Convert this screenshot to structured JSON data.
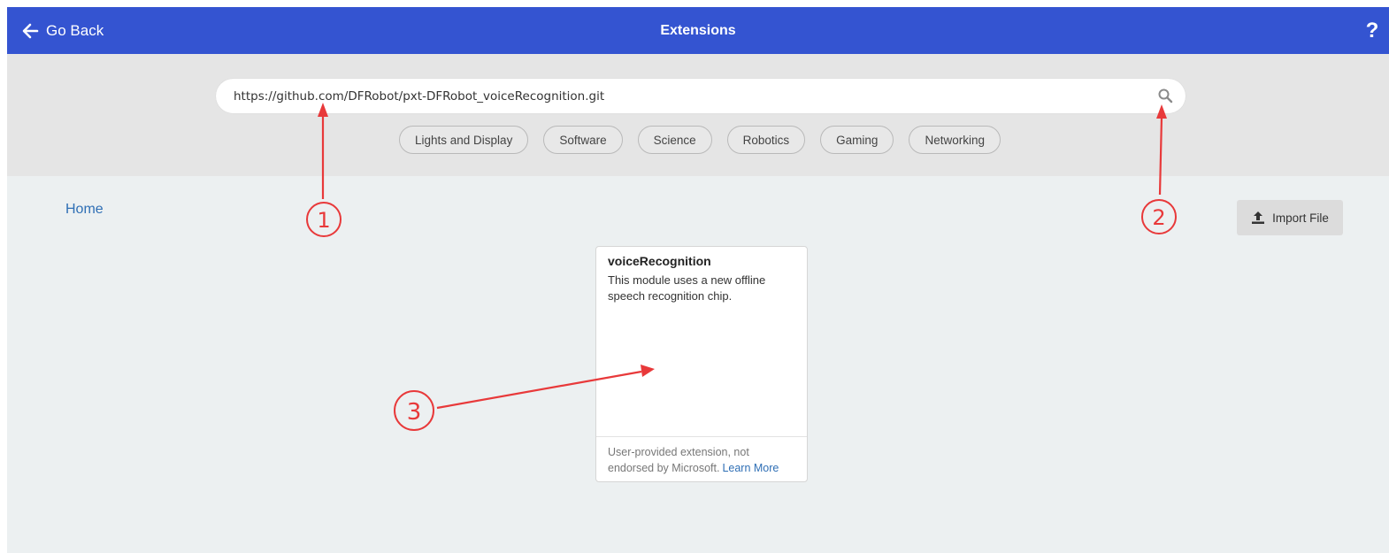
{
  "header": {
    "back_label": "Go Back",
    "title": "Extensions",
    "help_glyph": "?",
    "background_color": "#3454d1"
  },
  "search": {
    "value": "https://github.com/DFRobot/pxt-DFRobot_voiceRecognition.git",
    "icon": "search-icon"
  },
  "categories": [
    "Lights and Display",
    "Software",
    "Science",
    "Robotics",
    "Gaming",
    "Networking"
  ],
  "breadcrumb": {
    "home_label": "Home"
  },
  "import": {
    "label": "Import File",
    "icon": "upload-icon"
  },
  "results": [
    {
      "name": "voiceRecognition",
      "description": "This module uses a new offline speech recognition chip.",
      "disclaimer": "User-provided extension, not endorsed by Microsoft.",
      "learn_more": "Learn More"
    }
  ],
  "annotations": {
    "marker_1": "1",
    "marker_2": "2",
    "marker_3": "3",
    "color": "#e8393a"
  }
}
